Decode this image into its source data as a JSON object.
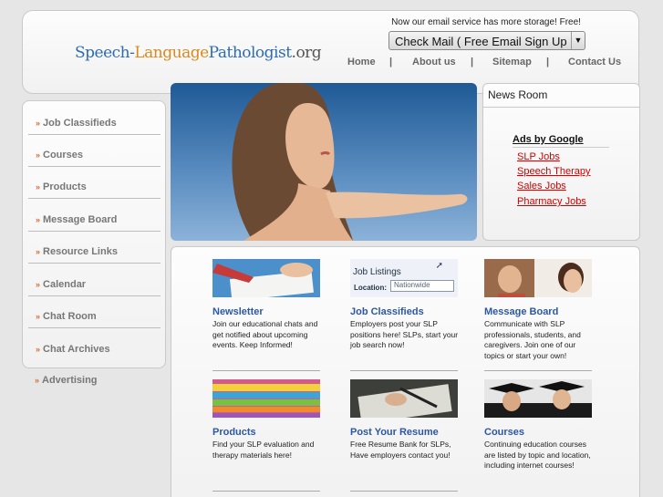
{
  "header": {
    "logo": {
      "part1": "Speech-",
      "part2": "Language",
      "part3": "Pathologist",
      "part4": ".org"
    },
    "promo_text": "Now our email service has more storage! Free!",
    "email_select_value": "Check Mail ( Free Email Sign Up",
    "nav": [
      "Home",
      "About us",
      "Sitemap",
      "Contact Us"
    ],
    "nav_separator": "|"
  },
  "sidebar": {
    "bullet": "»",
    "items": [
      "Job Classifieds",
      "Courses",
      "Products",
      "Message Board",
      "Resource Links",
      "Calendar",
      "Chat Room",
      "Chat Archives",
      "Advertising"
    ]
  },
  "newsroom": {
    "title": "News Room",
    "ads_title": "Ads by Google",
    "ads": [
      "SLP Jobs",
      "Speech Therapy",
      "Sales Jobs",
      "Pharmacy Jobs"
    ]
  },
  "features": [
    {
      "title": "Newsletter",
      "desc": "Join our educational chats and get notified about upcoming events. Keep Informed!"
    },
    {
      "title": "Job Classifieds",
      "desc": "Employers post your SLP positions here! SLPs, start your job search now!",
      "image_text": [
        "Job Listings",
        "Location:",
        "Nationwide"
      ]
    },
    {
      "title": "Message Board",
      "desc": "Communicate with SLP professionals, students, and caregivers. Join one of our topics or start your own!"
    },
    {
      "title": "Products",
      "desc": "Find your SLP evaluation and therapy materials here!"
    },
    {
      "title": "Post Your Resume",
      "desc": "Free Resume Bank for SLPs, Have employers contact you!"
    },
    {
      "title": "Courses",
      "desc": "Continuing education courses are listed by topic and location, including internet courses!"
    }
  ],
  "colors": {
    "accent_blue": "#2b57a5",
    "ad_red": "#d40000",
    "bullet_orange": "#d26b3b"
  }
}
